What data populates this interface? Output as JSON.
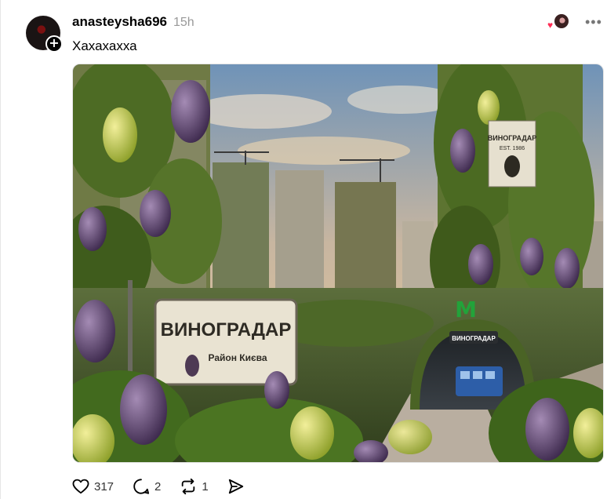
{
  "post": {
    "username": "anasteysha696",
    "timestamp": "15h",
    "caption": "Хахахахха",
    "more_label": "•••",
    "avatar_add_label": "+"
  },
  "image": {
    "sign_title": "ВИНОГРАДАР",
    "sign_subtitle": "Район Києва",
    "tower_label": "ВИНОГРАДАР",
    "tower_est": "EST. 1986",
    "metro_logo": "M",
    "metro_arch_label": "ВИНОГРАДАР"
  },
  "actions": {
    "likes": "317",
    "comments": "2",
    "reposts": "1"
  },
  "icons": [
    "heart-icon",
    "comment-icon",
    "repost-icon",
    "share-icon",
    "more-icon"
  ],
  "colors": {
    "accent_heart": "#ff2d55",
    "metro_green": "#22a33a"
  }
}
